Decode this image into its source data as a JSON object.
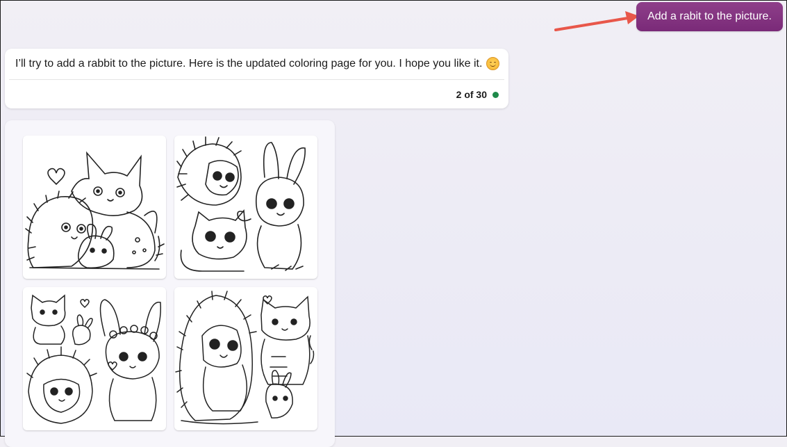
{
  "user_message": {
    "text": "Add a rabit to the picture."
  },
  "bot_message": {
    "text": "I’ll try to add a rabbit to the picture. Here is the updated coloring page for you. I hope you like it.",
    "emoji": "smiling-face-icon",
    "counter": "2 of 30",
    "status_color": "#1e8a4a"
  },
  "images": [
    {
      "name": "cat-hedgehog-bunny-coloring"
    },
    {
      "name": "hedgehog-rabbit-cat-coloring"
    },
    {
      "name": "cat-bunny-hedgehog-flower-coloring"
    },
    {
      "name": "hedgehog-cat-rabbit-coloring"
    }
  ],
  "colors": {
    "user_bubble": "#7a2a78",
    "arrow": "#e8574a"
  }
}
